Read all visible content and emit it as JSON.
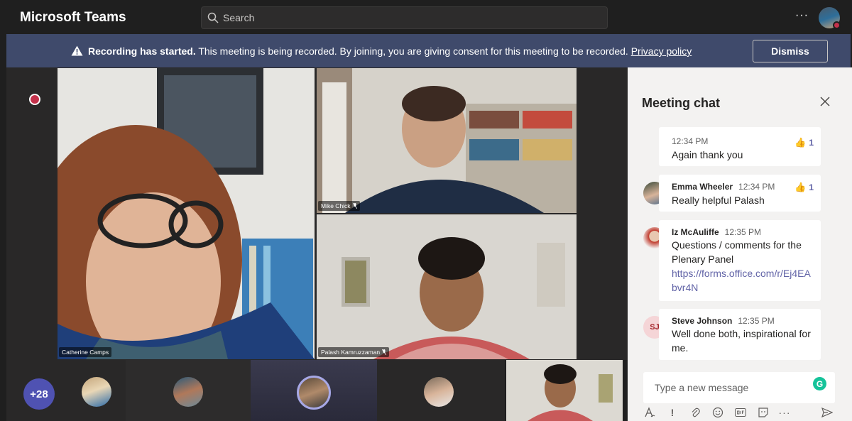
{
  "app": {
    "title": "Microsoft Teams"
  },
  "search": {
    "placeholder": "Search"
  },
  "top_actions": {
    "more": "···"
  },
  "banner": {
    "title": "Recording has started.",
    "message": " This meeting is being recorded. By joining, you are giving consent for this meeting to be recorded. ",
    "link": "Privacy policy",
    "dismiss_label": "Dismiss"
  },
  "participants": {
    "catherine": "Catherine Camps",
    "mike": "Mike Chick",
    "palash": "Palash Kamruzzaman"
  },
  "thumbnails": {
    "overflow_count": "+28"
  },
  "chat": {
    "title": "Meeting chat",
    "messages": [
      {
        "author": "",
        "time": "12:34 PM",
        "body": "Again thank you",
        "likes": "1"
      },
      {
        "author": "Emma Wheeler",
        "time": "12:34 PM",
        "body": "Really helpful Palash",
        "likes": "1"
      },
      {
        "author": "Iz McAuliffe",
        "time": "12:35 PM",
        "body": "Questions / comments for the Plenary Panel",
        "link": "https://forms.office.com/r/Ej4EAbvr4N"
      },
      {
        "author": "Steve Johnson",
        "initials": "SJ",
        "time": "12:35 PM",
        "body": "Well done both, inspirational for me."
      }
    ],
    "compose_placeholder": "Type a new message",
    "grammarly": "G"
  },
  "colors": {
    "brand": "#6264a7",
    "banner": "#3f4a6b",
    "status_busy": "#c4314b"
  }
}
